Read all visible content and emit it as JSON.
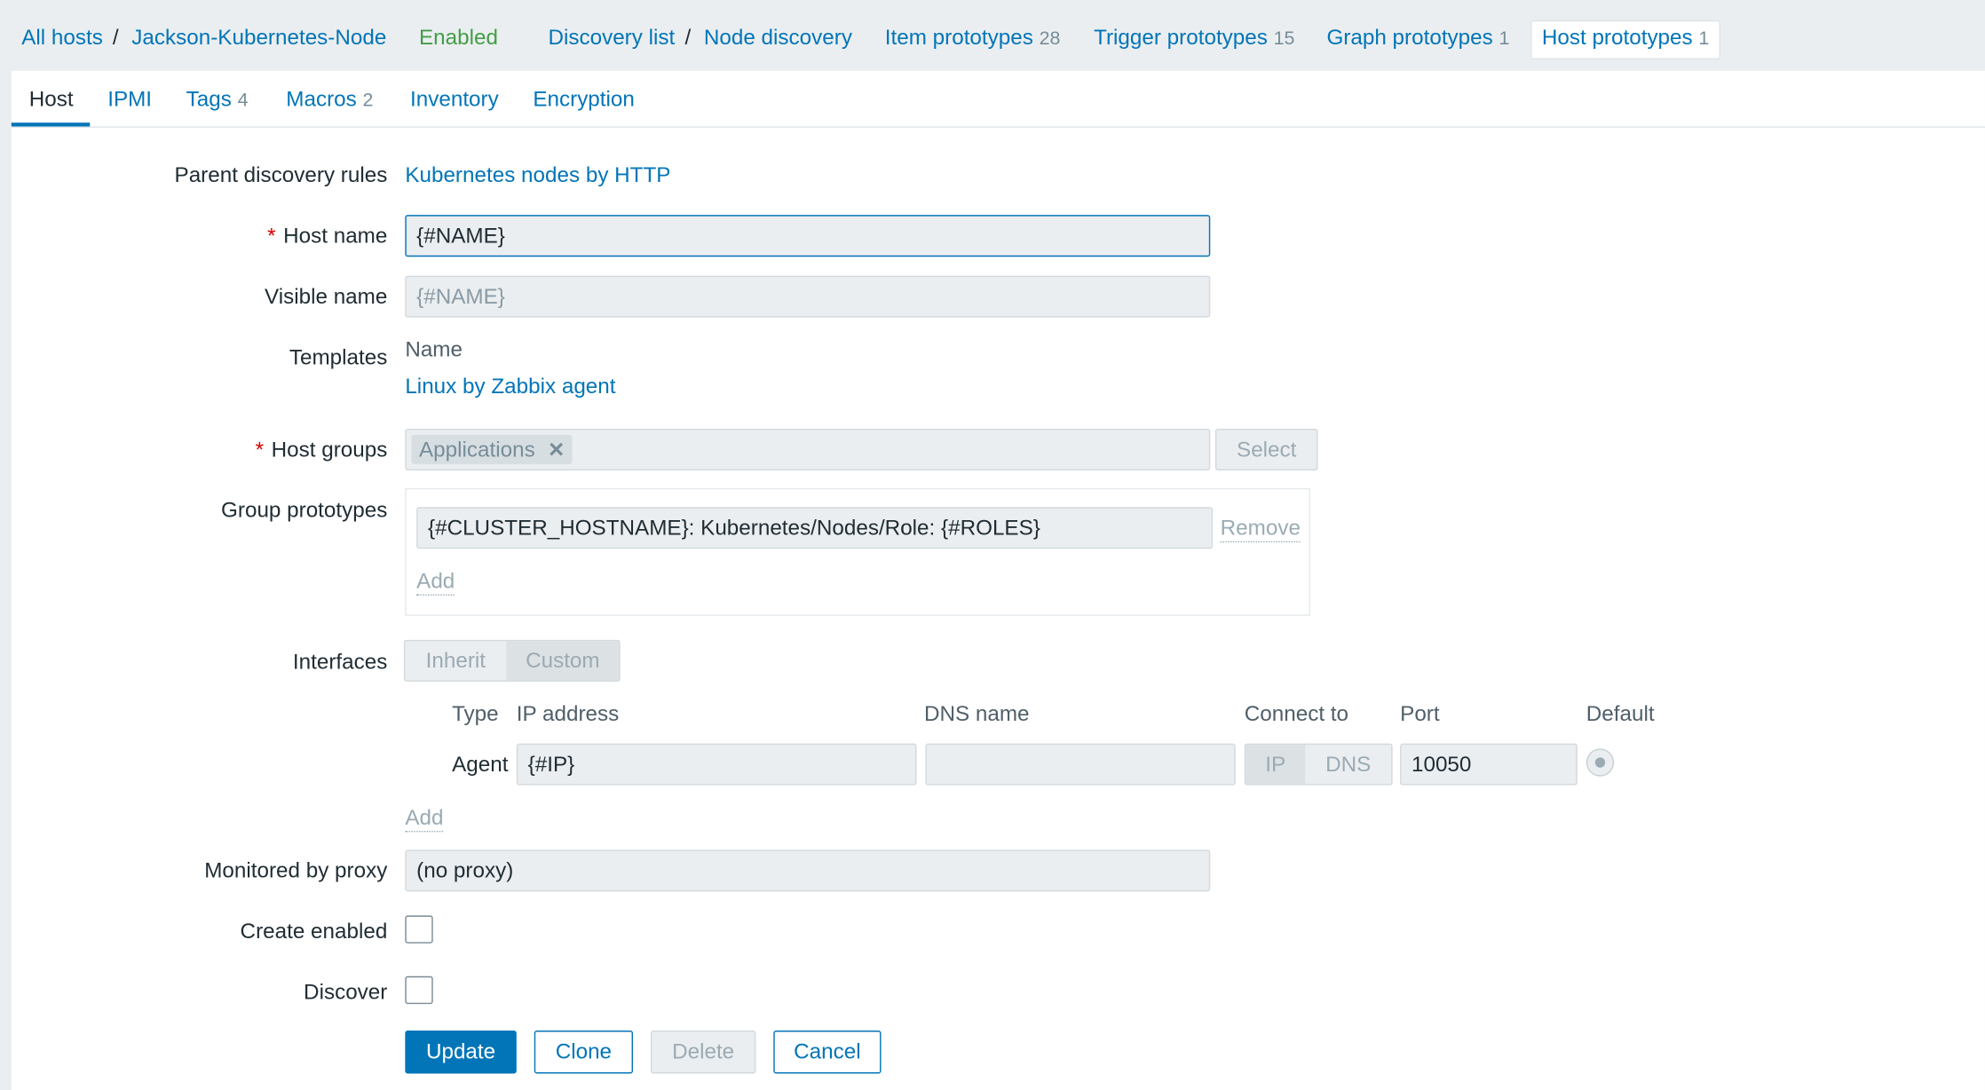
{
  "breadcrumb": {
    "all_hosts": "All hosts",
    "host": "Jackson-Kubernetes-Node",
    "status": "Enabled",
    "discovery_list": "Discovery list",
    "node_discovery": "Node discovery",
    "item_prototypes": {
      "label": "Item prototypes",
      "count": "28"
    },
    "trigger_prototypes": {
      "label": "Trigger prototypes",
      "count": "15"
    },
    "graph_prototypes": {
      "label": "Graph prototypes",
      "count": "1"
    },
    "host_prototypes": {
      "label": "Host prototypes",
      "count": "1"
    },
    "separator": "/"
  },
  "tabs": {
    "host": "Host",
    "ipmi": "IPMI",
    "tags": {
      "label": "Tags",
      "count": "4"
    },
    "macros": {
      "label": "Macros",
      "count": "2"
    },
    "inventory": "Inventory",
    "encryption": "Encryption"
  },
  "form": {
    "parent_discovery_rules": {
      "label": "Parent discovery rules",
      "value": "Kubernetes nodes by HTTP"
    },
    "host_name": {
      "label": "Host name",
      "value": "{#NAME}"
    },
    "visible_name": {
      "label": "Visible name",
      "placeholder": "{#NAME}"
    },
    "templates": {
      "label": "Templates",
      "column": "Name",
      "value": "Linux by Zabbix agent"
    },
    "host_groups": {
      "label": "Host groups",
      "chip": "Applications",
      "select": "Select"
    },
    "group_prototypes": {
      "label": "Group prototypes",
      "value": "{#CLUSTER_HOSTNAME}: Kubernetes/Nodes/Role: {#ROLES}",
      "remove": "Remove",
      "add": "Add"
    },
    "interfaces": {
      "label": "Interfaces",
      "mode_inherit": "Inherit",
      "mode_custom": "Custom",
      "columns": {
        "type": "Type",
        "ip": "IP address",
        "dns": "DNS name",
        "connect": "Connect to",
        "port": "Port",
        "default": "Default"
      },
      "row": {
        "type": "Agent",
        "ip": "{#IP}",
        "dns": "",
        "connect_ip": "IP",
        "connect_dns": "DNS",
        "port": "10050"
      },
      "add": "Add"
    },
    "proxy": {
      "label": "Monitored by proxy",
      "value": "(no proxy)"
    },
    "create_enabled": {
      "label": "Create enabled"
    },
    "discover": {
      "label": "Discover"
    }
  },
  "buttons": {
    "update": "Update",
    "clone": "Clone",
    "delete": "Delete",
    "cancel": "Cancel"
  },
  "colors": {
    "link": "#0275b8",
    "enabled": "#429e47",
    "required": "#d40000",
    "primary": "#0275b8"
  }
}
